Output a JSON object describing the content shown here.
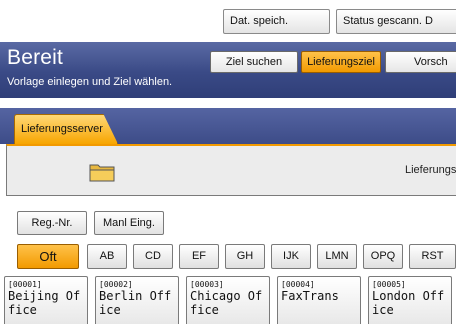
{
  "topbar": {
    "save_label": "Dat. speich.",
    "status_label": "Status gescann. D"
  },
  "header": {
    "title": "Bereit",
    "subtitle": "Vorlage einlegen und Ziel wählen.",
    "search_label": "Ziel suchen",
    "delivery_dest_label": "Lieferungsziel",
    "preview_label": "Vorsch"
  },
  "tabs": {
    "delivery_server": "Lieferungsserver"
  },
  "panel": {
    "label": "Lieferungs"
  },
  "buttons": {
    "reg_nr": "Reg.-Nr.",
    "manual_entry": "Manl Eing."
  },
  "index_tabs": [
    "Oft",
    "AB",
    "CD",
    "EF",
    "GH",
    "IJK",
    "LMN",
    "OPQ",
    "RST"
  ],
  "index_selected": "Oft",
  "entries": [
    {
      "num": "[00001]",
      "line1": "Beijing Of",
      "line2": "fice"
    },
    {
      "num": "[00002]",
      "line1": "Berlin Off",
      "line2": "ice"
    },
    {
      "num": "[00003]",
      "line1": "Chicago Of",
      "line2": "fice"
    },
    {
      "num": "[00004]",
      "line1": "FaxTrans",
      "line2": ""
    },
    {
      "num": "[00005]",
      "line1": "London Off",
      "line2": "ice"
    }
  ],
  "colors": {
    "accent": "#f29a00",
    "header": "#3a4a86"
  },
  "icons": {
    "panel_icon": "folder-icon"
  }
}
